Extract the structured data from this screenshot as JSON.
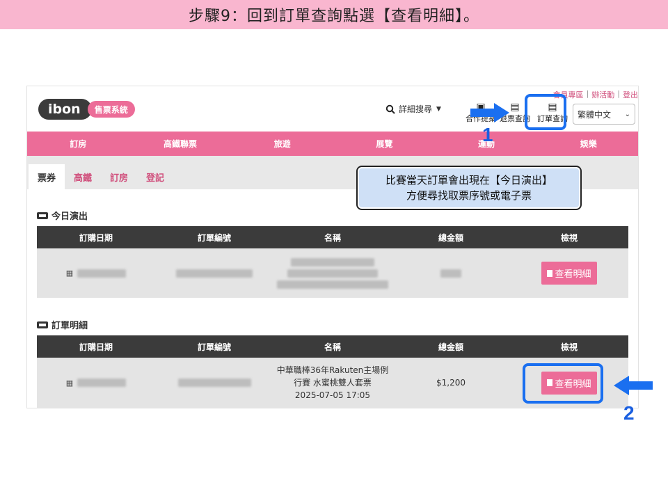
{
  "banner": {
    "title": "步驟9：回到訂單查詢點選【查看明細】。"
  },
  "header": {
    "logo_text": "ibon",
    "logo_tag": "售票系統",
    "search_label": "詳細搜尋",
    "top_links": [
      "會員專區",
      "辦活動",
      "登出"
    ],
    "icons": [
      {
        "label": "合作提案",
        "icon": "briefcase-icon"
      },
      {
        "label": "退票查詢",
        "icon": "receipt-icon"
      },
      {
        "label": "訂單查詢",
        "icon": "document-icon"
      }
    ],
    "language": "繁體中文"
  },
  "nav": [
    "訂房",
    "高鐵聯票",
    "旅遊",
    "展覽",
    "運動",
    "娛樂"
  ],
  "tabs": [
    "票券",
    "高鐵",
    "訂房",
    "登記"
  ],
  "today": {
    "title": "今日演出",
    "columns": [
      "訂購日期",
      "訂單編號",
      "名稱",
      "總金額",
      "檢視"
    ],
    "button": "查看明細"
  },
  "orders": {
    "title": "訂單明細",
    "columns": [
      "訂購日期",
      "訂單編號",
      "名稱",
      "總金額",
      "檢視"
    ],
    "row": {
      "name_line1": "中華職棒36年Rakuten主場例",
      "name_line2": "行賽  水蜜桃雙人套票",
      "name_line3": "2025-07-05  17:05",
      "amount": "$1,200",
      "button": "查看明細"
    }
  },
  "annotations": {
    "callout_line1": "比賽當天訂單會出現在【今日演出】",
    "callout_line2": "方便尋找取票序號或電子票",
    "step1": "1",
    "step2": "2"
  },
  "colors": {
    "pink": "#ec6c98",
    "banner": "#f9b6cf",
    "highlight": "#1a6ff0",
    "dark": "#3b3b3b"
  }
}
